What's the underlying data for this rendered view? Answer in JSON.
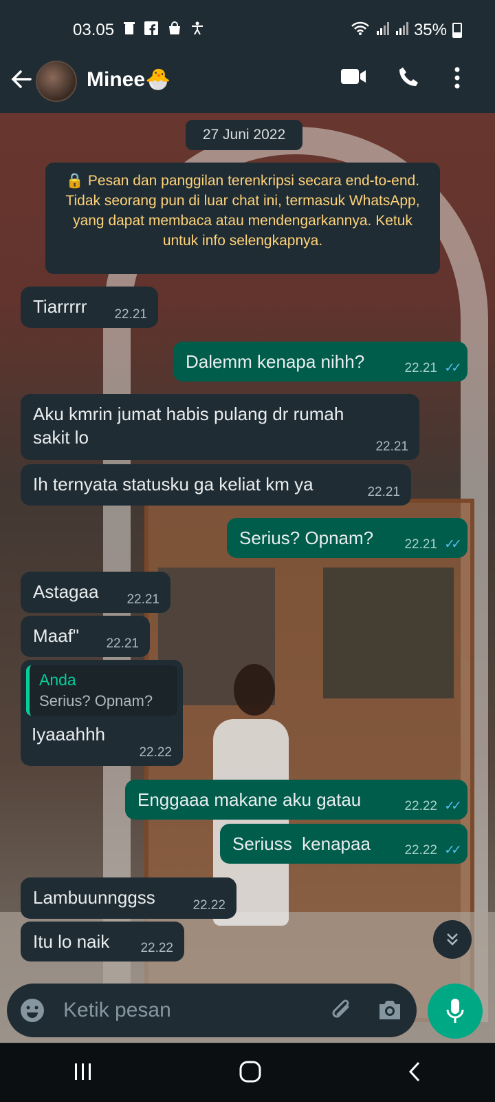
{
  "status_bar": {
    "time": "03.05",
    "battery": "35%",
    "icons": [
      "trash-icon",
      "facebook-icon",
      "shopping-bag-icon",
      "accessibility-icon",
      "wifi-icon",
      "signal-icon",
      "signal-icon",
      "battery-icon"
    ]
  },
  "header": {
    "contact_name": "Minee🐣",
    "icons": [
      "back-arrow-icon",
      "video-call-icon",
      "phone-icon",
      "more-options-icon"
    ]
  },
  "chat": {
    "date": "27 Juni 2022",
    "encryption_notice": "🔒 Pesan dan panggilan terenkripsi secara end-to-end. Tidak seorang pun di luar chat ini, termasuk WhatsApp, yang dapat membaca atau mendengarkannya. Ketuk untuk info selengkapnya.",
    "messages": [
      {
        "dir": "in",
        "text": "Tiarrrrr",
        "time": "22.21"
      },
      {
        "dir": "out",
        "text": "Dalemm kenapa nihh?",
        "time": "22.21"
      },
      {
        "dir": "in",
        "text": "Aku kmrin jumat habis pulang dr rumah\nsakit lo",
        "time": "22.21"
      },
      {
        "dir": "in",
        "text": "Ih ternyata statusku ga keliat km ya",
        "time": "22.21"
      },
      {
        "dir": "out",
        "text": "Serius? Opnam?",
        "time": "22.21"
      },
      {
        "dir": "in",
        "text": "Astagaa",
        "time": "22.21"
      },
      {
        "dir": "in",
        "text": "Maaf\"",
        "time": "22.21"
      },
      {
        "dir": "in",
        "text": "Iyaaahhh",
        "time": "22.22",
        "quote": {
          "author": "Anda",
          "text": "Serius? Opnam?"
        }
      },
      {
        "dir": "out",
        "text": "Enggaaa makane aku gatau",
        "time": "22.22"
      },
      {
        "dir": "out",
        "text": "Seriuss  kenapaa",
        "time": "22.22"
      },
      {
        "dir": "in",
        "text": "Lambuunnggss",
        "time": "22.22"
      },
      {
        "dir": "in",
        "text": "Itu lo naik",
        "time": "22.22"
      }
    ]
  },
  "input": {
    "placeholder": "Ketik pesan"
  },
  "colors": {
    "bar": "#202c33",
    "incoming": "#202c33",
    "outgoing": "#005c4b",
    "accent": "#00a884",
    "read_ticks": "#53bdeb",
    "notice_text": "#ffd279"
  }
}
